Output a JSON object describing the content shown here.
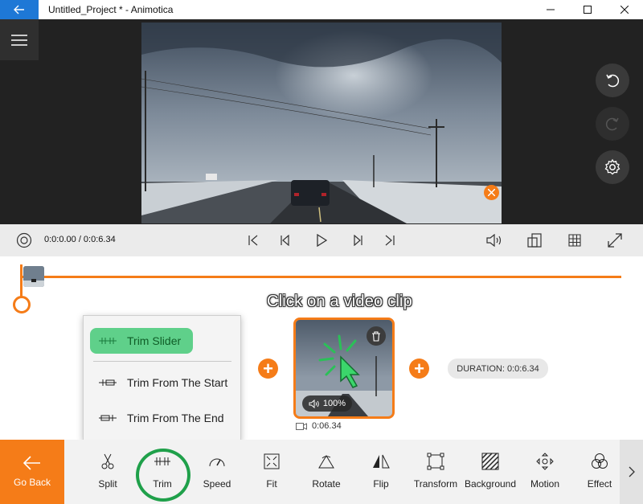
{
  "window": {
    "title": "Untitled_Project * - Animotica",
    "back_icon": "arrow-left-icon",
    "minimize_icon": "minimize-icon",
    "maximize_icon": "maximize-icon",
    "close_icon": "close-icon"
  },
  "colors": {
    "accent": "#f57c18",
    "titlebar_back": "#1e78d6",
    "highlight": "#5fd08a",
    "ring": "#1fa04a"
  },
  "player": {
    "timecode": "0:0:0.00 / 0:0:6.34",
    "icons": [
      "settings-wheel-icon",
      "skip-start-icon",
      "step-back-icon",
      "play-icon",
      "step-forward-icon",
      "skip-end-icon",
      "volume-icon",
      "aspect-ratio-icon",
      "grid-icon",
      "fullscreen-icon"
    ]
  },
  "side_buttons": [
    "undo-icon",
    "redo-icon",
    "gear-icon"
  ],
  "timeline": {
    "hint": "Click on a video clip",
    "clip": {
      "volume": "100%",
      "duration": "0:06.34"
    },
    "duration_label": "DURATION: 0:0:6.34",
    "add_symbol": "+"
  },
  "trim_menu": {
    "items": [
      {
        "label": "Trim Slider",
        "icon": "trim-slider-icon"
      },
      {
        "label": "Trim From The Start",
        "icon": "trim-start-icon"
      },
      {
        "label": "Trim From The End",
        "icon": "trim-end-icon"
      }
    ]
  },
  "toolbar": {
    "go_back": "Go Back",
    "tools": [
      {
        "label": "Split",
        "icon": "scissors-icon"
      },
      {
        "label": "Trim",
        "icon": "trim-icon"
      },
      {
        "label": "Speed",
        "icon": "speedometer-icon"
      },
      {
        "label": "Fit",
        "icon": "fit-icon"
      },
      {
        "label": "Rotate",
        "icon": "rotate-icon"
      },
      {
        "label": "Flip",
        "icon": "flip-icon"
      },
      {
        "label": "Transform",
        "icon": "transform-icon"
      },
      {
        "label": "Background",
        "icon": "background-icon"
      },
      {
        "label": "Motion",
        "icon": "motion-icon"
      },
      {
        "label": "Effect",
        "icon": "effect-icon"
      }
    ],
    "more_icon": "chevron-right-icon"
  }
}
